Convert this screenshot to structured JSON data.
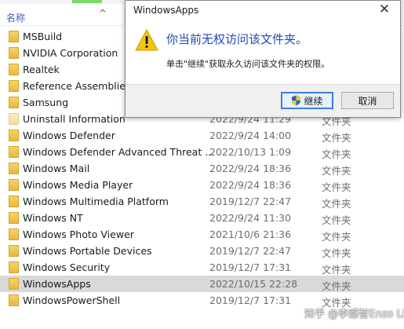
{
  "explorer": {
    "column_name": "名称",
    "rows": [
      {
        "name": "MSBuild",
        "date": "",
        "type": ""
      },
      {
        "name": "NVIDIA Corporation",
        "date": "",
        "type": ""
      },
      {
        "name": "Realtek",
        "date": "",
        "type": ""
      },
      {
        "name": "Reference Assemblies",
        "date": "",
        "type": ""
      },
      {
        "name": "Samsung",
        "date": "",
        "type": ""
      },
      {
        "name": "Uninstall Information",
        "date": "2022/9/24 11:29",
        "type": "文件夹"
      },
      {
        "name": "Windows Defender",
        "date": "2022/9/24 14:00",
        "type": "文件夹"
      },
      {
        "name": "Windows Defender Advanced Threat ...",
        "date": "2022/10/13 1:09",
        "type": "文件夹"
      },
      {
        "name": "Windows Mail",
        "date": "2022/9/24 18:36",
        "type": "文件夹"
      },
      {
        "name": "Windows Media Player",
        "date": "2022/9/24 18:36",
        "type": "文件夹"
      },
      {
        "name": "Windows Multimedia Platform",
        "date": "2019/12/7 22:47",
        "type": "文件夹"
      },
      {
        "name": "Windows NT",
        "date": "2022/9/24 11:30",
        "type": "文件夹"
      },
      {
        "name": "Windows Photo Viewer",
        "date": "2021/10/6 21:36",
        "type": "文件夹"
      },
      {
        "name": "Windows Portable Devices",
        "date": "2019/12/7 22:47",
        "type": "文件夹"
      },
      {
        "name": "Windows Security",
        "date": "2019/12/7 17:31",
        "type": "文件夹"
      },
      {
        "name": "WindowsApps",
        "date": "2022/10/15 22:28",
        "type": "文件夹"
      },
      {
        "name": "WindowsPowerShell",
        "date": "2019/12/7 17:31",
        "type": "文件夹"
      }
    ],
    "selected_index": 15
  },
  "dialog": {
    "title": "WindowsApps",
    "close_glyph": "✕",
    "heading": "你当前无权访问该文件夹。",
    "body": "单击\"继续\"获取永久访问该文件夹的权限。",
    "continue_label": "继续",
    "cancel_label": "取消"
  },
  "watermark": "知乎 @李感智Enzo Li",
  "colors": {
    "heading_blue": "#1e4bb5",
    "selected_row": "#d9d9d9",
    "folder_yellow": "#f0c64e",
    "warning_yellow": "#f4c312"
  }
}
